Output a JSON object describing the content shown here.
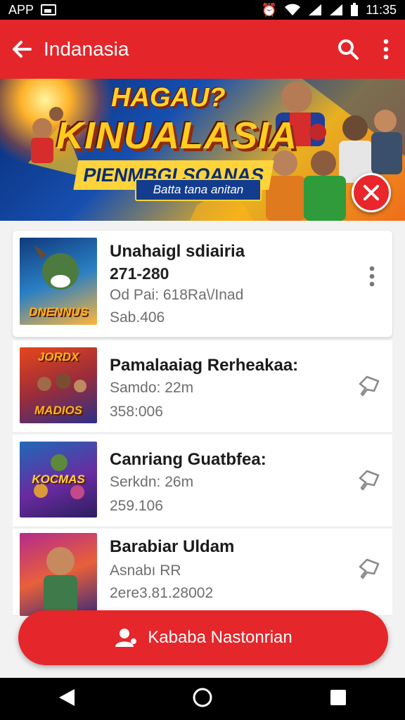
{
  "status_bar": {
    "left_label": "APP",
    "time": "11:35",
    "icons": [
      "image-icon",
      "alarm-icon",
      "wifi-icon",
      "signal-icon",
      "signal-icon",
      "battery-icon"
    ]
  },
  "toolbar": {
    "title": "Indanasia",
    "back_icon": "arrow-left-icon",
    "search_icon": "search-icon",
    "more_icon": "more-vertical-icon"
  },
  "banner": {
    "line1": "HAGAU?",
    "line2": "KINUALASIA",
    "subtitle": "PIENMBGI SOANAS",
    "tagline": "Batta tana anitan",
    "close_icon": "close-icon"
  },
  "items": [
    {
      "thumb_label": "DNENNUS",
      "title": "Unahaigl sdiairia",
      "line1": "271-280",
      "line2": "Od Pai: 618Ra\\/Inad",
      "line3": "Sab.406",
      "action_icon": "more-vertical-icon"
    },
    {
      "thumb_label": "JORDX",
      "thumb_label2": "MADIOS",
      "title": "Pamalaaiag Rerheakaa:",
      "line1": "Samdo: 22m",
      "line2": "358:006",
      "action_icon": "pin-icon"
    },
    {
      "thumb_label": "KOCMAS",
      "title": "Canriang Guatbfea:",
      "line1": "Serkdn: 26m",
      "line2": "259.106",
      "action_icon": "pin-icon"
    },
    {
      "thumb_label": "",
      "title": "Barabiar Uldam",
      "line1": "Asnabı RR",
      "line2": "2ere3.81.28002",
      "action_icon": "pin-icon"
    }
  ],
  "bottom_button": {
    "label": "Kababa Nastonrian",
    "icon": "user-icon"
  },
  "nav": {
    "back": "triangle-back-icon",
    "home": "circle-home-icon",
    "recents": "square-recents-icon"
  },
  "colors": {
    "primary": "#e4262b",
    "banner_blue": "#174fb0",
    "banner_gold": "#ffcc20"
  }
}
